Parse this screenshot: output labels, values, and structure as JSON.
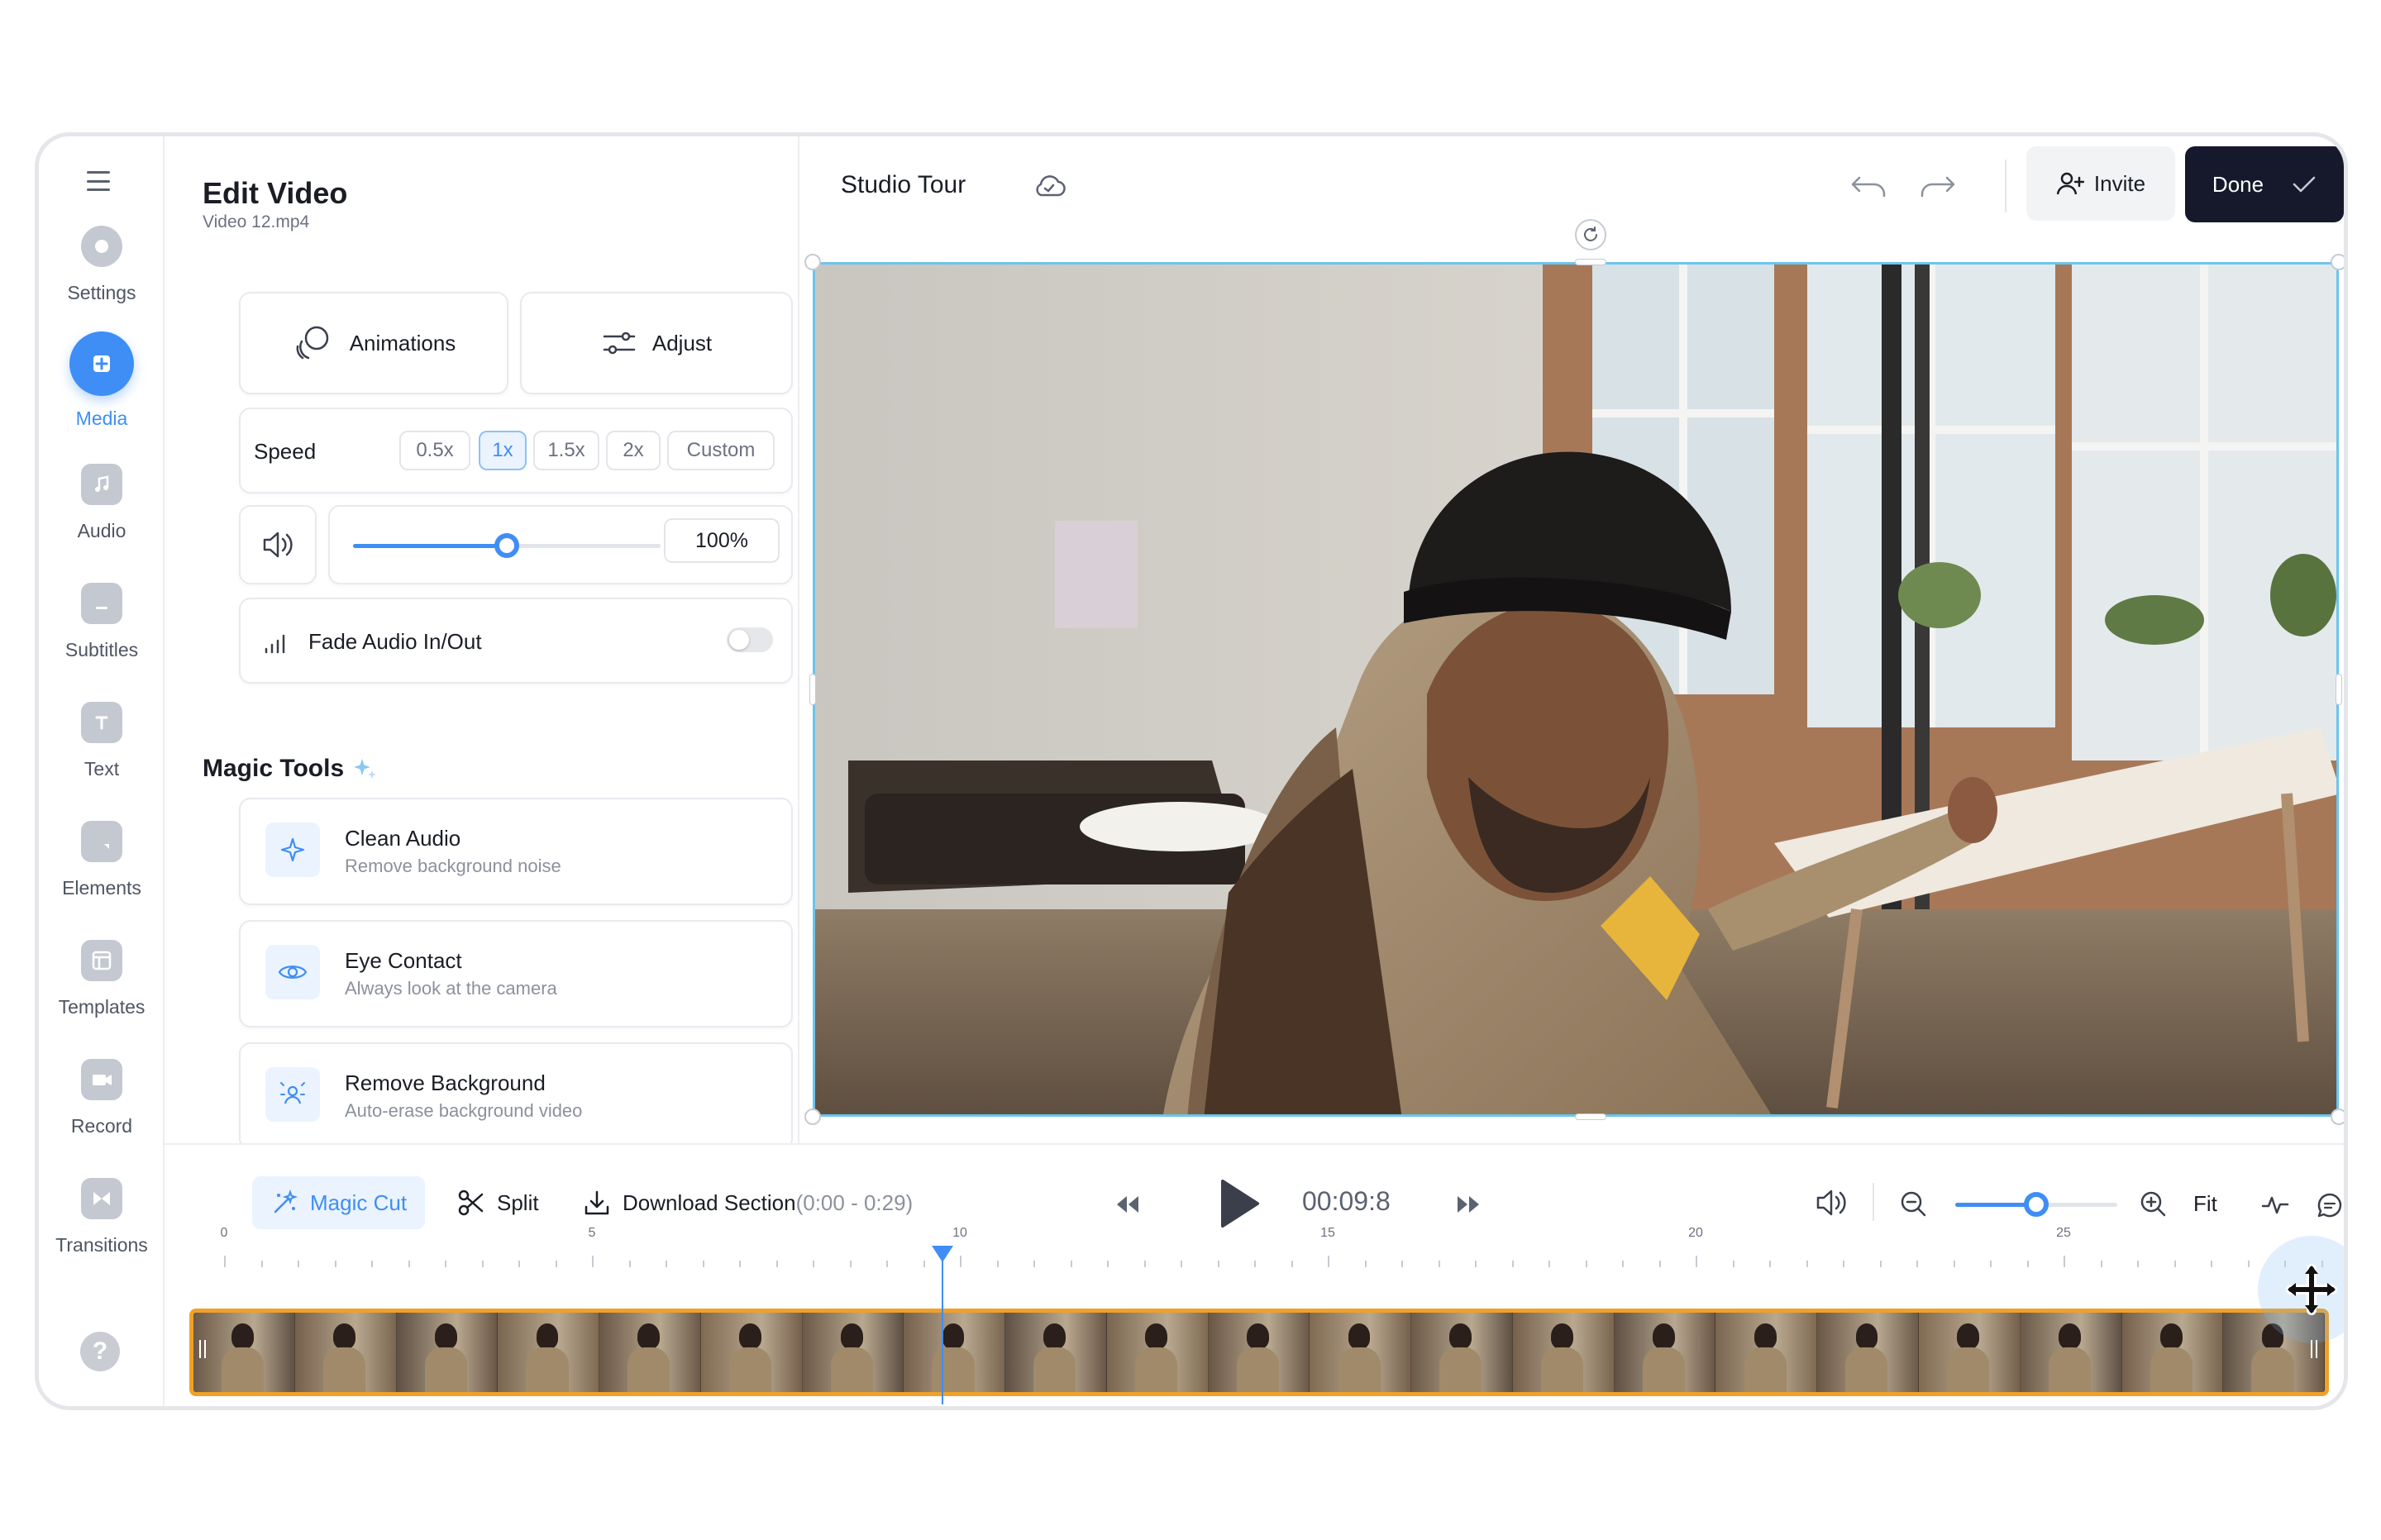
{
  "sidebar": {
    "items": [
      {
        "label": "Settings",
        "icon": "settings-icon"
      },
      {
        "label": "Media",
        "icon": "plus-icon",
        "active": true
      },
      {
        "label": "Audio",
        "icon": "music-icon"
      },
      {
        "label": "Subtitles",
        "icon": "subtitles-icon"
      },
      {
        "label": "Text",
        "icon": "text-icon"
      },
      {
        "label": "Elements",
        "icon": "elements-icon"
      },
      {
        "label": "Templates",
        "icon": "templates-icon"
      },
      {
        "label": "Record",
        "icon": "record-icon"
      },
      {
        "label": "Transitions",
        "icon": "transitions-icon"
      }
    ],
    "help_label": "?"
  },
  "edit_panel": {
    "title": "Edit Video",
    "filename": "Video 12.mp4",
    "animations_label": "Animations",
    "adjust_label": "Adjust",
    "speed": {
      "label": "Speed",
      "options": [
        "0.5x",
        "1x",
        "1.5x",
        "2x",
        "Custom"
      ],
      "selected": "1x"
    },
    "volume": {
      "value_label": "100%",
      "level": 0.5
    },
    "fade": {
      "label": "Fade Audio In/Out",
      "enabled": false
    },
    "magic_tools": {
      "title": "Magic Tools",
      "items": [
        {
          "title": "Clean Audio",
          "desc": "Remove background noise",
          "icon": "sparkle-icon"
        },
        {
          "title": "Eye Contact",
          "desc": "Always look at the camera",
          "icon": "eye-icon"
        },
        {
          "title": "Remove Background",
          "desc": "Auto-erase background video",
          "icon": "person-bg-icon"
        }
      ]
    }
  },
  "topbar": {
    "project_title": "Studio Tour",
    "invite_label": "Invite",
    "done_label": "Done"
  },
  "timeline": {
    "magic_cut_label": "Magic Cut",
    "split_label": "Split",
    "download_label": "Download Section",
    "download_range": "(0:00 - 0:29)",
    "timecode": "00:09:8",
    "fit_label": "Fit",
    "zoom_level": 0.5,
    "ruler_labels": [
      "0",
      "5",
      "10",
      "15",
      "20",
      "25"
    ]
  },
  "colors": {
    "accent": "#3f8ef5",
    "done_bg": "#16192b",
    "clip_border": "#f0a128",
    "selection": "#6cc5ec"
  }
}
